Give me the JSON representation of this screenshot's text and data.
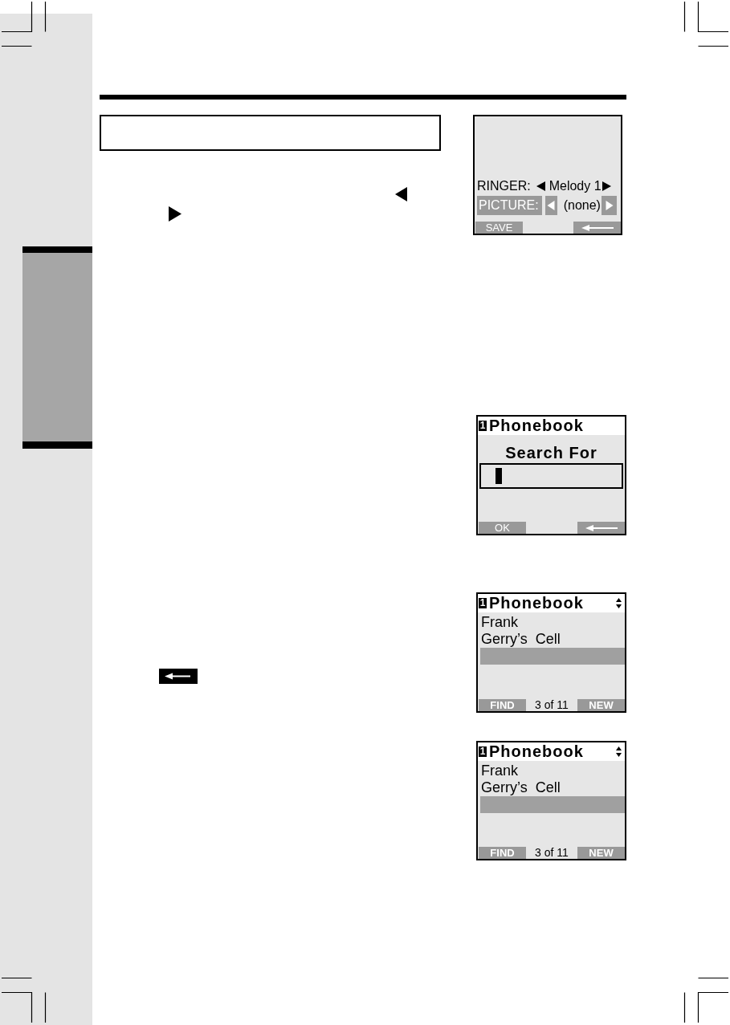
{
  "screens": [
    {
      "kind": "settings",
      "fields": [
        {
          "label": "RINGER:",
          "value": "Melody 1",
          "selected": false
        },
        {
          "label": "PICTURE:",
          "value": "(none)",
          "selected": true
        }
      ],
      "softkeys": [
        {
          "kind": "label",
          "label": "SAVE"
        },
        {
          "kind": "back"
        }
      ]
    },
    {
      "kind": "search",
      "header": {
        "badge": "1",
        "title": "Phonebook"
      },
      "prompt": "Search For",
      "softkeys": [
        {
          "kind": "label",
          "label": "OK"
        },
        {
          "kind": "back"
        }
      ]
    },
    {
      "kind": "list",
      "header": {
        "badge": "1",
        "title": "Phonebook"
      },
      "rows": [
        {
          "name": "Frank",
          "selected": false
        },
        {
          "name": "Gerry’s  Cell",
          "selected": false
        },
        {
          "selected": true
        }
      ],
      "counter": "3 of 11",
      "softkeys": [
        {
          "kind": "label",
          "label": "FIND"
        },
        {
          "kind": "label",
          "label": "NEW"
        }
      ]
    },
    {
      "kind": "list",
      "header": {
        "badge": "1",
        "title": "Phonebook"
      },
      "rows": [
        {
          "name": "Frank",
          "selected": false
        },
        {
          "name": "Gerry’s  Cell",
          "selected": false
        },
        {
          "selected": true
        }
      ],
      "counter": "3 of 11",
      "softkeys": [
        {
          "kind": "label",
          "label": "FIND"
        },
        {
          "kind": "label",
          "label": "NEW"
        }
      ]
    }
  ]
}
